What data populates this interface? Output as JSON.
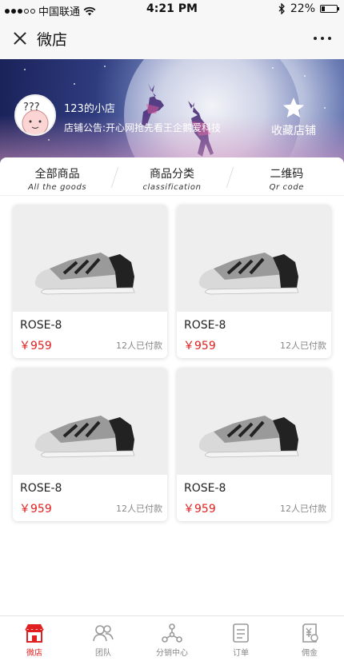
{
  "status": {
    "carrier": "中国联通",
    "time": "4:21 PM",
    "battery_percent": "22%",
    "battery_level": 0.22
  },
  "nav": {
    "title": "微店"
  },
  "shop": {
    "name": "123的小店",
    "notice": "店铺公告:开心网抢先看王企鹅爱科技",
    "avatar_text": "???",
    "favorite_label": "收藏店铺"
  },
  "tabs": [
    {
      "cn": "全部商品",
      "en": "All the goods"
    },
    {
      "cn": "商品分类",
      "en": "classification"
    },
    {
      "cn": "二维码",
      "en": "Qr code"
    }
  ],
  "products": [
    {
      "name": "ROSE-8",
      "price": "￥959",
      "sold": "12人已付款"
    },
    {
      "name": "ROSE-8",
      "price": "￥959",
      "sold": "12人已付款"
    },
    {
      "name": "ROSE-8",
      "price": "￥959",
      "sold": "12人已付款"
    },
    {
      "name": "ROSE-8",
      "price": "￥959",
      "sold": "12人已付款"
    }
  ],
  "tabbar": [
    {
      "label": "微店",
      "icon": "shop-icon",
      "active": true
    },
    {
      "label": "团队",
      "icon": "team-icon",
      "active": false
    },
    {
      "label": "分销中心",
      "icon": "distribution-icon",
      "active": false
    },
    {
      "label": "订单",
      "icon": "order-icon",
      "active": false
    },
    {
      "label": "佣金",
      "icon": "commission-icon",
      "active": false
    }
  ],
  "colors": {
    "accent": "#e02020",
    "muted": "#888888"
  }
}
